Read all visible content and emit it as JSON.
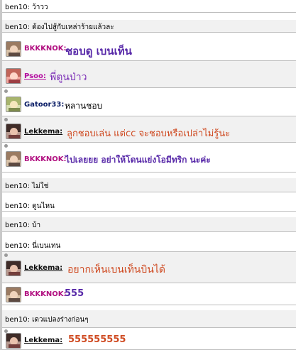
{
  "colors": {
    "system_text": "#000000",
    "bkkknok": "#b10f80",
    "bkkknok_message": "#5728a8",
    "psoo": "#b40ea0",
    "psoo_message": "#7a2cb6",
    "gatoor": "#0a1d66",
    "gatoor_message": "#000000",
    "lekkema": "#101010",
    "lekkema_message": "#cf4a21"
  },
  "chat": {
    "rows": [
      {
        "kind": "system",
        "text": "ben10: ว้าวว"
      },
      {
        "kind": "system",
        "text": "ben10: ต้องไปสู้กับเหล่าร้ายแล้วละ"
      },
      {
        "kind": "message",
        "username": "BKKKNOK:",
        "message": "ชอบดู เบนเท็น",
        "avatar": "bkkknok-avatar-icon"
      },
      {
        "kind": "message",
        "username": "Psoo:",
        "message": "พี่ตูนป่าว",
        "avatar": "psoo-avatar-icon"
      },
      {
        "kind": "message",
        "username": "Gatoor33:",
        "message": "หลานชอบ",
        "avatar": "gatoor-avatar-icon"
      },
      {
        "kind": "message",
        "username": "Lekkema:",
        "message": "ลูกชอบเล่น แต่cc จะชอบหรือเปล่าไม่รู้นะ",
        "avatar": "lekkema-avatar-icon"
      },
      {
        "kind": "message",
        "username": "BKKKNOK:",
        "message": "ไปเลยยย อย่าให้โดนแย่งโอมีทริก นะค่ะ",
        "avatar": "bkkknok-avatar-icon"
      },
      {
        "kind": "system",
        "text": "ben10: ไม่ใช่"
      },
      {
        "kind": "system",
        "text": "ben10: ตูนไหน"
      },
      {
        "kind": "system",
        "text": "ben10: บ้า"
      },
      {
        "kind": "system",
        "text": "ben10: นี่เบนเทน"
      },
      {
        "kind": "message",
        "username": "Lekkema:",
        "message": "อยากเห็นเบนเท็นบินได้",
        "avatar": "lekkema-avatar-icon"
      },
      {
        "kind": "message",
        "username": "BKKKNOK:",
        "message": "555",
        "avatar": "bkkknok-avatar-icon"
      },
      {
        "kind": "system",
        "text": "ben10: เดวแปลงร่างก่อนๆ"
      },
      {
        "kind": "message",
        "username": "Lekkema:",
        "message": "555555555",
        "avatar": "lekkema-avatar-icon"
      }
    ]
  }
}
